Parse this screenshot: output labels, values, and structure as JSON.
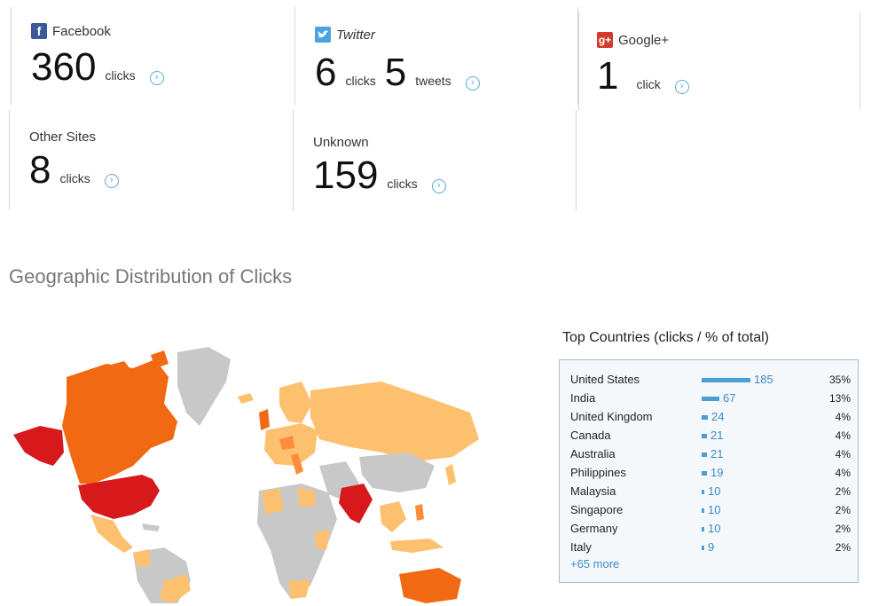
{
  "cards": {
    "facebook": {
      "label": "Facebook",
      "value": "360",
      "unit": "clicks"
    },
    "twitter": {
      "label": "Twitter",
      "value": "6",
      "unit": "clicks",
      "value2": "5",
      "unit2": "tweets"
    },
    "google": {
      "label": "Google+",
      "value": "1",
      "unit": "click"
    },
    "other": {
      "label": "Other Sites",
      "value": "8",
      "unit": "clicks"
    },
    "unknown": {
      "label": "Unknown",
      "value": "159",
      "unit": "clicks"
    }
  },
  "geo_title": "Geographic Distribution of Clicks",
  "top_countries": {
    "title": "Top Countries (clicks / % of total)",
    "more": "+65 more",
    "rows": [
      {
        "name": "United States",
        "count": "185",
        "pct": "35%",
        "value": 185
      },
      {
        "name": "India",
        "count": "67",
        "pct": "13%",
        "value": 67
      },
      {
        "name": "United Kingdom",
        "count": "24",
        "pct": "4%",
        "value": 24
      },
      {
        "name": "Canada",
        "count": "21",
        "pct": "4%",
        "value": 21
      },
      {
        "name": "Australia",
        "count": "21",
        "pct": "4%",
        "value": 21
      },
      {
        "name": "Philippines",
        "count": "19",
        "pct": "4%",
        "value": 19
      },
      {
        "name": "Malaysia",
        "count": "10",
        "pct": "2%",
        "value": 10
      },
      {
        "name": "Singapore",
        "count": "10",
        "pct": "2%",
        "value": 10
      },
      {
        "name": "Germany",
        "count": "10",
        "pct": "2%",
        "value": 10
      },
      {
        "name": "Italy",
        "count": "9",
        "pct": "2%",
        "value": 9
      }
    ]
  },
  "colors": {
    "high": "#d7191c",
    "medium_high": "#f16913",
    "medium": "#fd8d3c",
    "low": "#fdc06f",
    "none": "#c8c8c8",
    "accent": "#4a9fd5"
  },
  "icons": {
    "facebook": "facebook-logo-icon",
    "twitter": "twitter-bird-icon",
    "google": "google-plus-icon",
    "arrow": "arrow-circle-right-icon"
  }
}
